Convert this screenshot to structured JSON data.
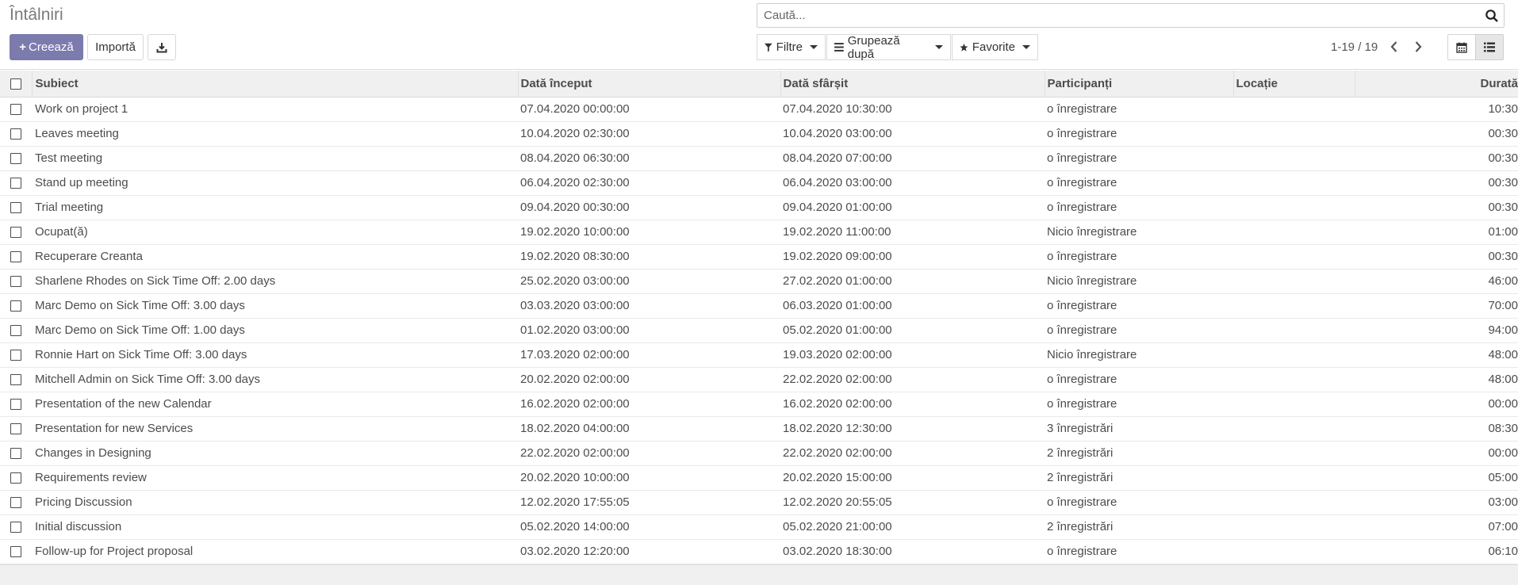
{
  "header": {
    "title": "Întâlniri",
    "create_label": "Creează",
    "import_label": "Importă",
    "download_icon": "download-icon"
  },
  "search": {
    "placeholder": "Caută...",
    "icon": "search-icon"
  },
  "filters": {
    "filters_label": "Filtre",
    "groupby_label": "Grupează după",
    "favorites_label": "Favorite"
  },
  "pager": {
    "text": "1-19 / 19"
  },
  "views": {
    "calendar": "calendar-icon",
    "list": "list-icon",
    "active": "list"
  },
  "table": {
    "columns": [
      "Subiect",
      "Dată început",
      "Dată sfârșit",
      "Participanți",
      "Locație",
      "Durată"
    ],
    "rows": [
      {
        "subject": "Work on project 1",
        "start": "07.04.2020 00:00:00",
        "end": "07.04.2020 10:30:00",
        "attendees": "o înregistrare",
        "location": "",
        "duration": "10:30"
      },
      {
        "subject": "Leaves meeting",
        "start": "10.04.2020 02:30:00",
        "end": "10.04.2020 03:00:00",
        "attendees": "o înregistrare",
        "location": "",
        "duration": "00:30"
      },
      {
        "subject": "Test meeting",
        "start": "08.04.2020 06:30:00",
        "end": "08.04.2020 07:00:00",
        "attendees": "o înregistrare",
        "location": "",
        "duration": "00:30"
      },
      {
        "subject": "Stand up meeting",
        "start": "06.04.2020 02:30:00",
        "end": "06.04.2020 03:00:00",
        "attendees": "o înregistrare",
        "location": "",
        "duration": "00:30"
      },
      {
        "subject": "Trial meeting",
        "start": "09.04.2020 00:30:00",
        "end": "09.04.2020 01:00:00",
        "attendees": "o înregistrare",
        "location": "",
        "duration": "00:30"
      },
      {
        "subject": "Ocupat(ă)",
        "start": "19.02.2020 10:00:00",
        "end": "19.02.2020 11:00:00",
        "attendees": "Nicio înregistrare",
        "location": "",
        "duration": "01:00"
      },
      {
        "subject": "Recuperare Creanta",
        "start": "19.02.2020 08:30:00",
        "end": "19.02.2020 09:00:00",
        "attendees": "o înregistrare",
        "location": "",
        "duration": "00:30"
      },
      {
        "subject": "Sharlene Rhodes on Sick Time Off: 2.00 days",
        "start": "25.02.2020 03:00:00",
        "end": "27.02.2020 01:00:00",
        "attendees": "Nicio înregistrare",
        "location": "",
        "duration": "46:00"
      },
      {
        "subject": "Marc Demo on Sick Time Off: 3.00 days",
        "start": "03.03.2020 03:00:00",
        "end": "06.03.2020 01:00:00",
        "attendees": "o înregistrare",
        "location": "",
        "duration": "70:00"
      },
      {
        "subject": "Marc Demo on Sick Time Off: 1.00 days",
        "start": "01.02.2020 03:00:00",
        "end": "05.02.2020 01:00:00",
        "attendees": "o înregistrare",
        "location": "",
        "duration": "94:00"
      },
      {
        "subject": "Ronnie Hart on Sick Time Off: 3.00 days",
        "start": "17.03.2020 02:00:00",
        "end": "19.03.2020 02:00:00",
        "attendees": "Nicio înregistrare",
        "location": "",
        "duration": "48:00"
      },
      {
        "subject": "Mitchell Admin on Sick Time Off: 3.00 days",
        "start": "20.02.2020 02:00:00",
        "end": "22.02.2020 02:00:00",
        "attendees": "o înregistrare",
        "location": "",
        "duration": "48:00"
      },
      {
        "subject": "Presentation of the new Calendar",
        "start": "16.02.2020 02:00:00",
        "end": "16.02.2020 02:00:00",
        "attendees": "o înregistrare",
        "location": "",
        "duration": "00:00"
      },
      {
        "subject": "Presentation for new Services",
        "start": "18.02.2020 04:00:00",
        "end": "18.02.2020 12:30:00",
        "attendees": "3 înregistrări",
        "location": "",
        "duration": "08:30"
      },
      {
        "subject": "Changes in Designing",
        "start": "22.02.2020 02:00:00",
        "end": "22.02.2020 02:00:00",
        "attendees": "2 înregistrări",
        "location": "",
        "duration": "00:00"
      },
      {
        "subject": "Requirements review",
        "start": "20.02.2020 10:00:00",
        "end": "20.02.2020 15:00:00",
        "attendees": "2 înregistrări",
        "location": "",
        "duration": "05:00"
      },
      {
        "subject": "Pricing Discussion",
        "start": "12.02.2020 17:55:05",
        "end": "12.02.2020 20:55:05",
        "attendees": "o înregistrare",
        "location": "",
        "duration": "03:00"
      },
      {
        "subject": "Initial discussion",
        "start": "05.02.2020 14:00:00",
        "end": "05.02.2020 21:00:00",
        "attendees": "2 înregistrări",
        "location": "",
        "duration": "07:00"
      },
      {
        "subject": "Follow-up for Project proposal",
        "start": "03.02.2020 12:20:00",
        "end": "03.02.2020 18:30:00",
        "attendees": "o înregistrare",
        "location": "",
        "duration": "06:10"
      }
    ]
  },
  "colors": {
    "primary": "#7c7bad",
    "header_bg": "#f0f0f0",
    "text": "#4c4c4c"
  }
}
